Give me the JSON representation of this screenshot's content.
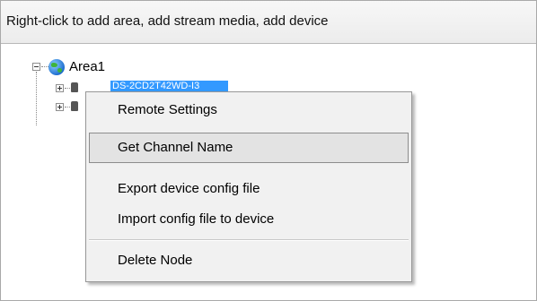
{
  "hint": "Right-click to add area, add stream media, add device",
  "tree": {
    "area_label": "Area1",
    "selected_node_text": "DS-2CD2T42WD-I3",
    "area_icon": "globe-icon",
    "device_icon": "device-icon"
  },
  "context_menu": {
    "items": [
      {
        "label": "Remote Settings"
      },
      {
        "label": "Get Channel Name"
      },
      {
        "label": "Export device config file"
      },
      {
        "label": "Import config file to device"
      },
      {
        "label": "Delete Node"
      }
    ],
    "hovered_item": "Get Channel Name"
  }
}
